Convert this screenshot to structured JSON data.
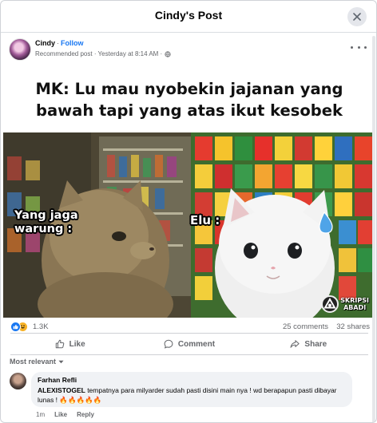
{
  "header": {
    "title": "Cindy's Post"
  },
  "post": {
    "author": "Cindy",
    "follow_label": "Follow",
    "meta": "Recommended post · Yesterday at 8:14 AM ·",
    "meme": {
      "caption_line1": "MK: Lu mau nyobekin jajanan yang",
      "caption_line2": "bawah tapi yang atas ikut kesobek",
      "label_left_line1": "Yang jaga",
      "label_left_line2": "warung :",
      "label_right": "Elu :",
      "watermark_line1": "SKRIPSI",
      "watermark_line2": "ABADI"
    },
    "reactions_count": "1.3K",
    "comments_count": "25 comments",
    "shares_count": "32 shares"
  },
  "actions": {
    "like": "Like",
    "comment": "Comment",
    "share": "Share"
  },
  "comments": {
    "sort_label": "Most relevant",
    "items": [
      {
        "author": "Farhan Refli",
        "mention": "ALEXISTOGEL",
        "text": " tempatnya para milyarder sudah pasti disini main nya ! wd berapapun pasti dibayar lunas ! 🔥🔥🔥🔥🔥",
        "time": "1m",
        "like_label": "Like",
        "reply_label": "Reply"
      }
    ]
  },
  "colors": {
    "accent": "#1877f2",
    "secondary_text": "#65676b",
    "bubble": "#f0f2f5"
  }
}
